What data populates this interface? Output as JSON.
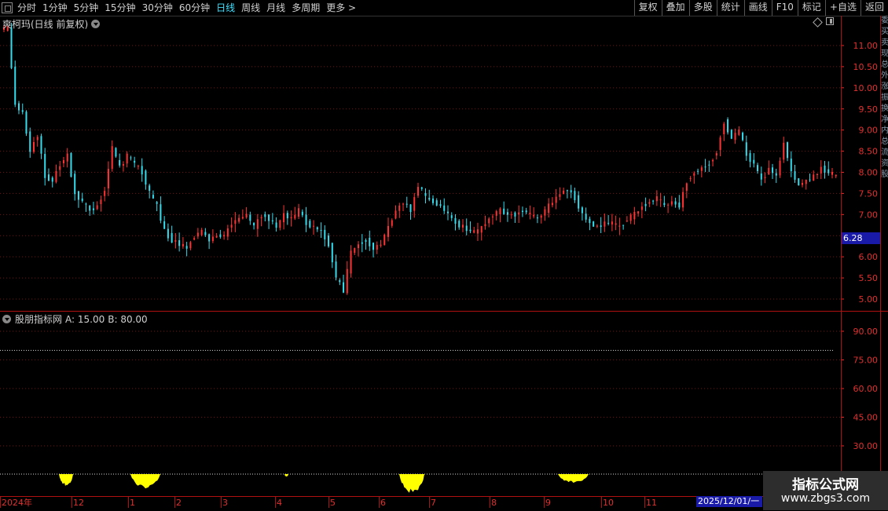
{
  "toolbar": {
    "periods": [
      "分时",
      "1分钟",
      "5分钟",
      "15分钟",
      "30分钟",
      "60分钟",
      "日线",
      "周线",
      "月线",
      "多周期",
      "更多 >"
    ],
    "active_period": "日线",
    "buttons": [
      "复权",
      "叠加",
      "多股",
      "统计",
      "画线",
      "F10",
      "标记",
      "+自选",
      "返回"
    ]
  },
  "main_chart": {
    "title": "爽柯玛(日线 前复权)",
    "last_price": "6.28",
    "y_ticks": [
      "11.00",
      "10.50",
      "10.00",
      "9.50",
      "9.00",
      "8.50",
      "8.00",
      "7.50",
      "7.00",
      "6.50",
      "6.00",
      "5.50",
      "5.00"
    ]
  },
  "indicator": {
    "name": "股朋指标网",
    "param_a": "A: 15.00",
    "param_b": "B: 80.00",
    "y_ticks": [
      "90.00",
      "75.00",
      "60.00",
      "45.00",
      "30.00"
    ]
  },
  "xaxis": {
    "labels": [
      "2024年",
      "12",
      "1",
      "2",
      "3",
      "4",
      "5",
      "6",
      "7",
      "8",
      "9",
      "10",
      "11"
    ],
    "cursor_date": "2025/12/01/一"
  },
  "side_strip": [
    "委",
    "买",
    "卖",
    "现",
    "总",
    "外",
    "涨",
    "振",
    "换",
    "净",
    "内",
    "总",
    "流",
    "资",
    "股"
  ],
  "watermark": {
    "line1": "指标公式网",
    "line2": "www.zbgs3.com"
  },
  "colors": {
    "up": "#ff3333",
    "down": "#33ddee",
    "grid": "#7a0f0f",
    "axis": "#e03030",
    "indicator": "#ffff00"
  },
  "chart_data": {
    "type": "candlestick",
    "ylim": [
      4.9,
      11.4
    ],
    "points": [
      11.4,
      9.6,
      9.4,
      8.5,
      8.9,
      7.9,
      7.8,
      8.2,
      8.4,
      7.5,
      7.3,
      7.1,
      7.2,
      7.6,
      8.6,
      8.1,
      8.4,
      8.2,
      8.0,
      7.5,
      7.2,
      6.6,
      6.4,
      6.3,
      6.2,
      6.5,
      6.6,
      6.4,
      6.5,
      6.5,
      6.8,
      6.9,
      7.0,
      6.7,
      7.0,
      6.9,
      6.7,
      7.0,
      6.9,
      7.1,
      6.8,
      6.7,
      6.6,
      6.3,
      5.5,
      5.2,
      6.1,
      6.3,
      6.4,
      6.2,
      6.3,
      6.7,
      7.1,
      7.3,
      7.1,
      7.7,
      7.4,
      7.3,
      7.2,
      7.0,
      6.8,
      6.7,
      6.6,
      6.6,
      6.8,
      7.0,
      7.1,
      7.0,
      7.0,
      7.1,
      7.0,
      6.9,
      7.1,
      7.3,
      7.5,
      7.6,
      7.4,
      7.0,
      6.8,
      6.7,
      6.8,
      6.8,
      6.7,
      6.9,
      7.0,
      7.2,
      7.3,
      7.4,
      7.2,
      7.3,
      7.2,
      7.8,
      8.0,
      8.1,
      8.2,
      8.5,
      9.2,
      8.8,
      9.0,
      8.4,
      8.2,
      7.8,
      8.1,
      7.9,
      8.7,
      8.0,
      7.7,
      7.8,
      7.9,
      8.1,
      8.0,
      7.9
    ],
    "indicator_yellow": [
      [
        75,
        93,
        14
      ],
      [
        166,
        204,
        16
      ],
      [
        362,
        367,
        3
      ],
      [
        508,
        540,
        22
      ],
      [
        710,
        749,
        10
      ]
    ],
    "indicator_level": 80
  }
}
